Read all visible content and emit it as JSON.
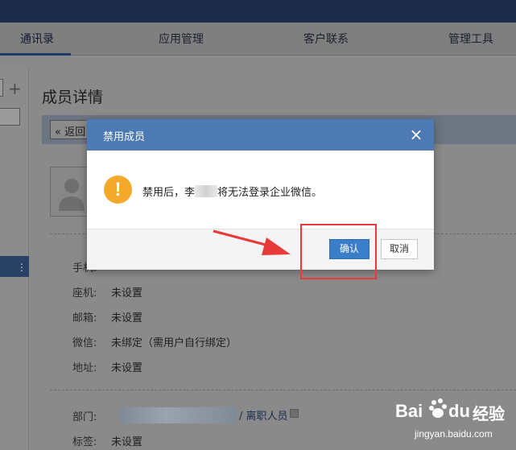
{
  "nav": {
    "tabs": [
      "通讯录",
      "应用管理",
      "客户联系",
      "管理工具"
    ]
  },
  "sidebar": {
    "add_label": "+",
    "menu_label": "⋮"
  },
  "page": {
    "title": "成员详情",
    "back_label": "« 返回"
  },
  "info": {
    "fields": [
      {
        "label": "手机:",
        "value": ""
      },
      {
        "label": "座机:",
        "value": "未设置"
      },
      {
        "label": "邮箱:",
        "value": "未设置"
      },
      {
        "label": "微信:",
        "value": "未绑定（需用户自行绑定）"
      },
      {
        "label": "地址:",
        "value": "未设置"
      }
    ],
    "dept_label": "部门:",
    "dept_link": "/ 离职人员",
    "tags_label": "标签:",
    "tags_value": "未设置"
  },
  "dialog": {
    "title": "禁用成员",
    "close_label": "×",
    "warn_symbol": "!",
    "message_pre": "禁用后，李",
    "message_post": "将无法登录企业微信。",
    "confirm_label": "确认",
    "cancel_label": "取消"
  },
  "watermark": {
    "brand": "Bai",
    "brand2": "du",
    "suffix": "经验",
    "url": "jingyan.baidu.com"
  },
  "colors": {
    "dialog_header": "#4e7ab4",
    "confirm_button": "#3a7dc9",
    "warning": "#f4a92a",
    "highlight": "#e83a3a"
  }
}
